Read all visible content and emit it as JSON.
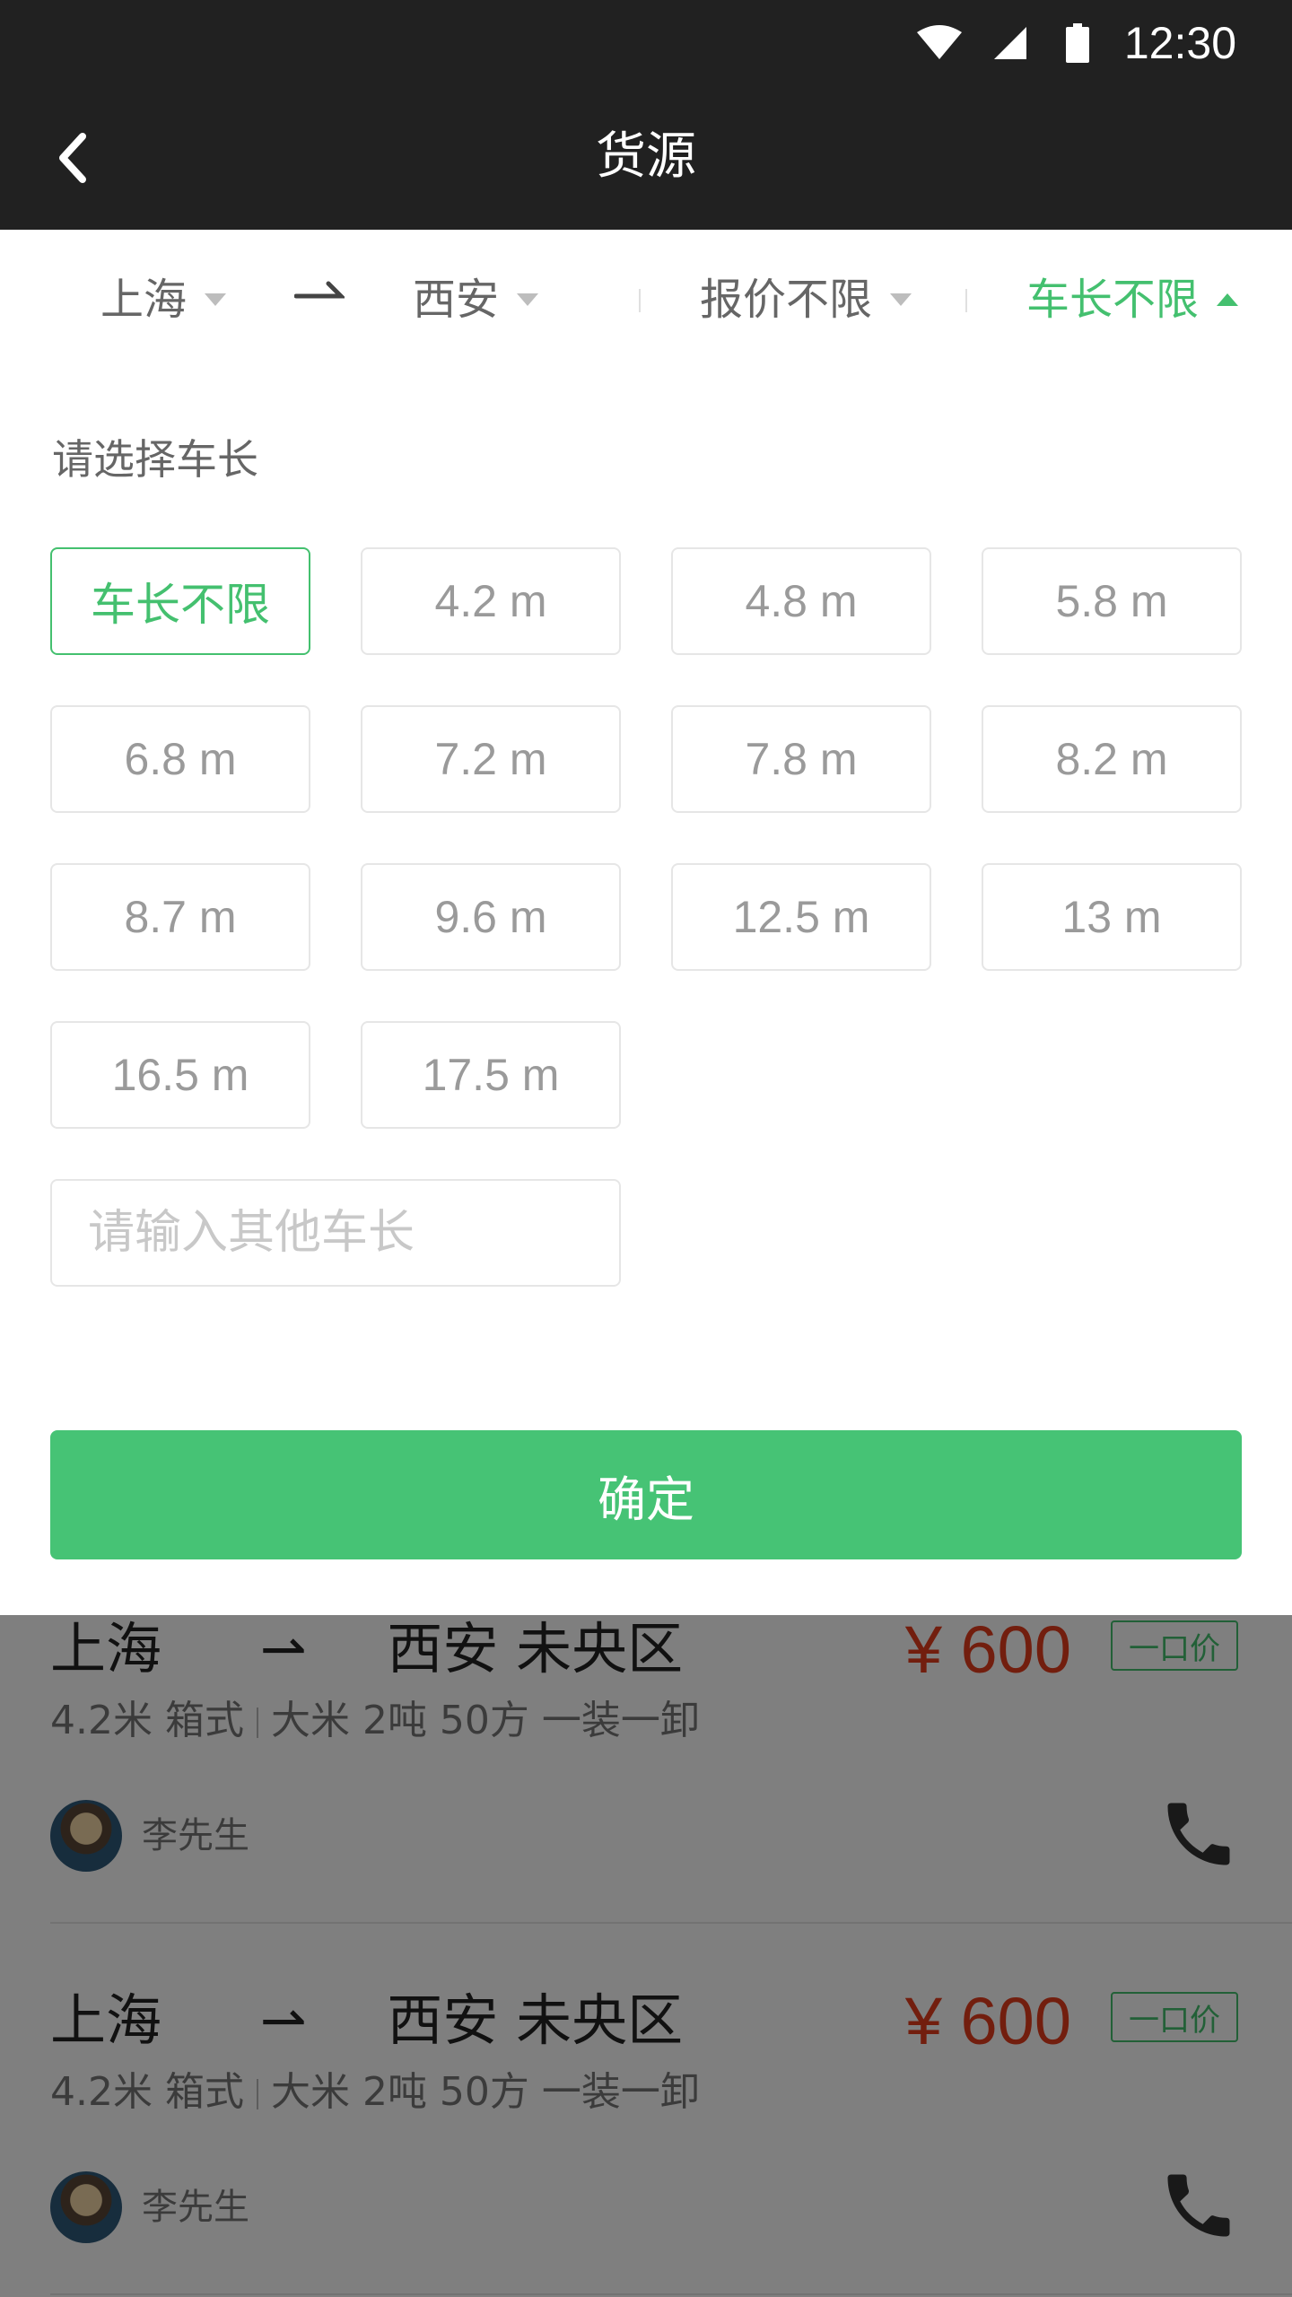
{
  "status_bar": {
    "time": "12:30",
    "icons": [
      "wifi-icon",
      "signal-icon",
      "battery-icon"
    ]
  },
  "app_bar": {
    "title": "货源",
    "back_icon": "chevron-left-icon"
  },
  "filters": {
    "from": "上海",
    "to": "西安",
    "price": "报价不限",
    "length": "车长不限",
    "active": "length"
  },
  "panel": {
    "label": "请选择车长",
    "options": [
      "车长不限",
      "4.2 m",
      "4.8 m",
      "5.8 m",
      "6.8 m",
      "7.2 m",
      "7.8 m",
      "8.2 m",
      "8.7 m",
      "9.6 m",
      "12.5 m",
      "13 m",
      "16.5 m",
      "17.5 m"
    ],
    "selected_index": 0,
    "other_placeholder": "请输入其他车长",
    "confirm_label": "确定"
  },
  "listings": [
    {
      "from": "上海",
      "to": "西安 未央区",
      "price": "¥ 600",
      "tag": "一口价",
      "detail_a": "4.2米  箱式",
      "detail_b": "大米  2吨  50方  一装一卸",
      "contact": "李先生"
    },
    {
      "from": "上海",
      "to": "西安 未央区",
      "price": "¥ 600",
      "tag": "一口价",
      "detail_a": "4.2米  箱式",
      "detail_b": "大米  2吨  50方  一装一卸",
      "contact": "李先生"
    }
  ],
  "colors": {
    "accent": "#44c06f",
    "price": "#e53d1c",
    "dark_bar": "#212121"
  }
}
